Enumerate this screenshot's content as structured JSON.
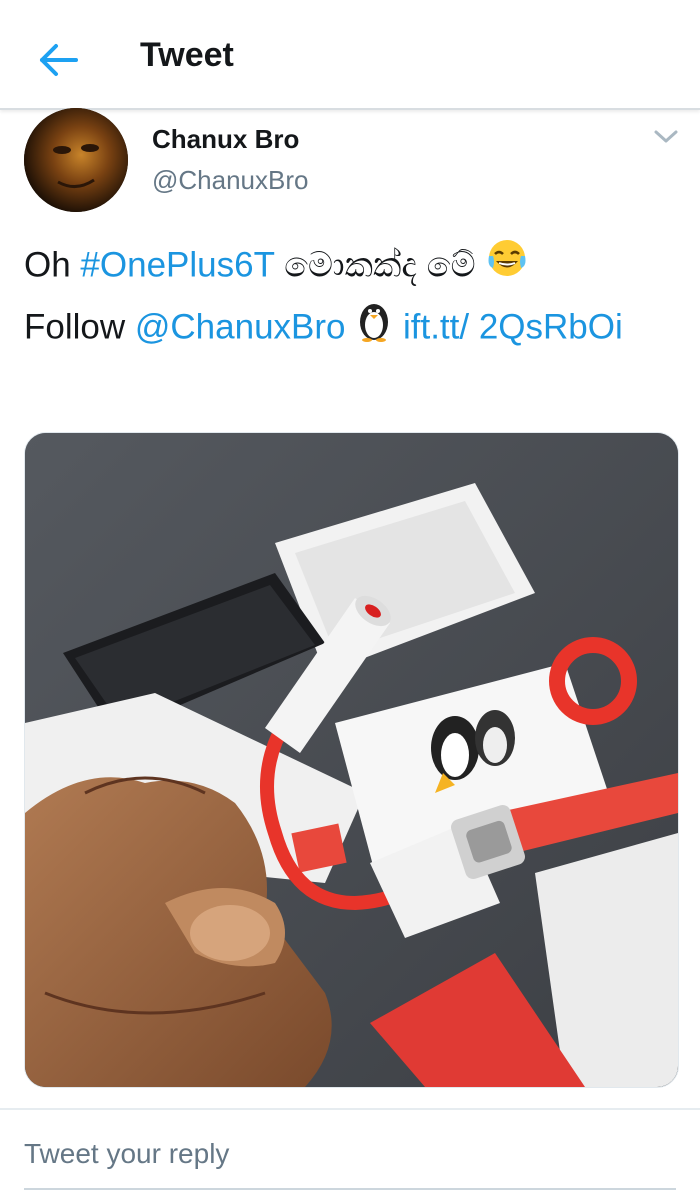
{
  "header": {
    "title": "Tweet",
    "back_icon": "arrow-left-icon"
  },
  "tweet": {
    "author_name": "Chanux Bro",
    "author_handle": "@ChanuxBro",
    "text": {
      "prefix": "Oh ",
      "hashtag": "#OnePlus6T",
      "sinhala": " මොකක්ද මේ ",
      "emoji1": "😂",
      "line2_prefix": "Follow ",
      "mention": "@ChanuxBro",
      "emoji2": "🐧",
      "link": "ift.tt/ 2QsRbOi"
    },
    "media_description": "photo"
  },
  "reply": {
    "placeholder": "Tweet your reply"
  },
  "colors": {
    "accent": "#1b95e0",
    "text": "#14171a",
    "muted": "#657786"
  }
}
